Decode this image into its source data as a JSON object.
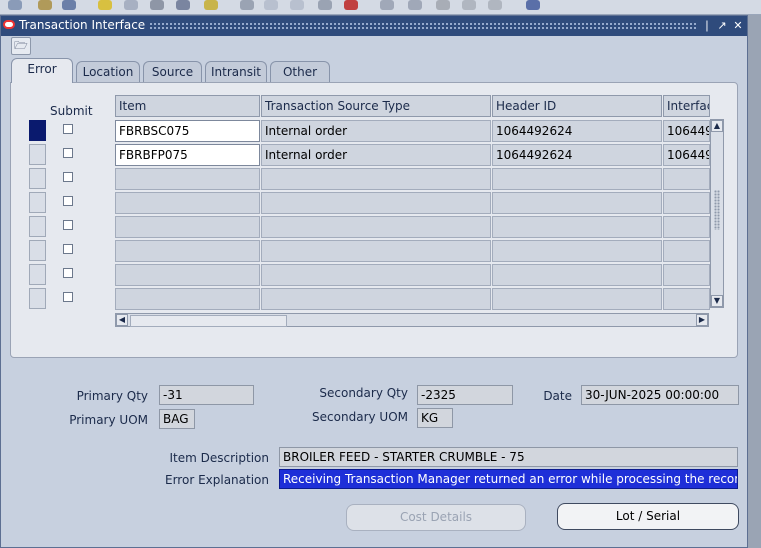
{
  "window": {
    "title": "Transaction Interface",
    "controls": [
      "❘",
      "↗",
      "✕"
    ]
  },
  "tabs": [
    {
      "label": "Error",
      "active": true
    },
    {
      "label": "Location",
      "active": false
    },
    {
      "label": "Source",
      "active": false
    },
    {
      "label": "Intransit",
      "active": false
    },
    {
      "label": "Other",
      "active": false
    }
  ],
  "grid": {
    "headers": {
      "submit": "Submit",
      "item": "Item",
      "source_type": "Transaction Source Type",
      "header_id": "Header ID",
      "interface": "Interfac"
    },
    "rows": [
      {
        "item": "FBRBSC075",
        "source_type": "Internal order",
        "header_id": "1064492624",
        "interface": "106449"
      },
      {
        "item": "FBRBFP075",
        "source_type": "Internal order",
        "header_id": "1064492624",
        "interface": "106449"
      }
    ]
  },
  "details": {
    "primary_qty_label": "Primary Qty",
    "primary_qty": "-31",
    "primary_uom_label": "Primary UOM",
    "primary_uom": "BAG",
    "secondary_qty_label": "Secondary Qty",
    "secondary_qty": "-2325",
    "secondary_uom_label": "Secondary UOM",
    "secondary_uom": "KG",
    "date_label": "Date",
    "date": "30-JUN-2025 00:00:00",
    "item_description_label": "Item Description",
    "item_description": "BROILER FEED - STARTER CRUMBLE - 75",
    "error_explanation_label": "Error Explanation",
    "error_explanation": "Receiving Transaction Manager returned an error while processing the record wi"
  },
  "buttons": {
    "cost_details": "Cost Details",
    "lot_serial": "Lot / Serial"
  }
}
